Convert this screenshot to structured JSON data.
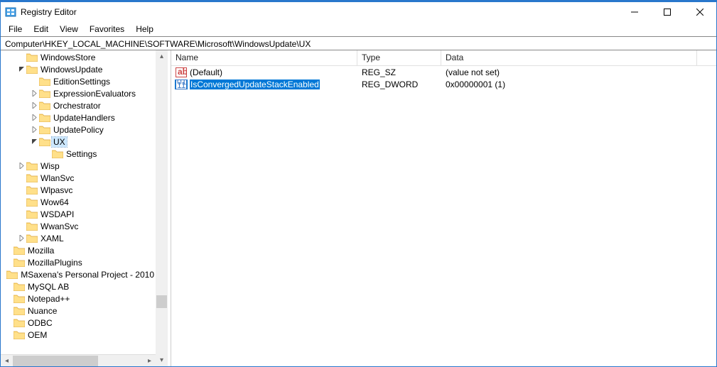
{
  "window": {
    "title": "Registry Editor"
  },
  "menu": {
    "file": "File",
    "edit": "Edit",
    "view": "View",
    "favorites": "Favorites",
    "help": "Help"
  },
  "address": "Computer\\HKEY_LOCAL_MACHINE\\SOFTWARE\\Microsoft\\WindowsUpdate\\UX",
  "tree": [
    {
      "depth": 1,
      "chev": "",
      "label": "WindowsStore"
    },
    {
      "depth": 1,
      "chev": "open",
      "label": "WindowsUpdate"
    },
    {
      "depth": 2,
      "chev": "",
      "label": "EditionSettings"
    },
    {
      "depth": 2,
      "chev": "closed",
      "label": "ExpressionEvaluators"
    },
    {
      "depth": 2,
      "chev": "closed",
      "label": "Orchestrator"
    },
    {
      "depth": 2,
      "chev": "closed",
      "label": "UpdateHandlers"
    },
    {
      "depth": 2,
      "chev": "closed",
      "label": "UpdatePolicy"
    },
    {
      "depth": 2,
      "chev": "open",
      "label": "UX",
      "sel": true
    },
    {
      "depth": 3,
      "chev": "",
      "label": "Settings"
    },
    {
      "depth": 1,
      "chev": "closed",
      "label": "Wisp"
    },
    {
      "depth": 1,
      "chev": "",
      "label": "WlanSvc"
    },
    {
      "depth": 1,
      "chev": "",
      "label": "Wlpasvc"
    },
    {
      "depth": 1,
      "chev": "",
      "label": "Wow64"
    },
    {
      "depth": 1,
      "chev": "",
      "label": "WSDAPI"
    },
    {
      "depth": 1,
      "chev": "",
      "label": "WwanSvc"
    },
    {
      "depth": 1,
      "chev": "closed",
      "label": "XAML"
    },
    {
      "depth": 0,
      "chev": "",
      "label": "Mozilla"
    },
    {
      "depth": 0,
      "chev": "",
      "label": "MozillaPlugins"
    },
    {
      "depth": 0,
      "chev": "",
      "label": "MSaxena's Personal Project - 2010"
    },
    {
      "depth": 0,
      "chev": "",
      "label": "MySQL AB"
    },
    {
      "depth": 0,
      "chev": "",
      "label": "Notepad++"
    },
    {
      "depth": 0,
      "chev": "",
      "label": "Nuance"
    },
    {
      "depth": 0,
      "chev": "",
      "label": "ODBC"
    },
    {
      "depth": 0,
      "chev": "",
      "label": "OEM"
    }
  ],
  "columns": {
    "name": "Name",
    "type": "Type",
    "data": "Data"
  },
  "values": [
    {
      "icon": "string",
      "name": "(Default)",
      "type": "REG_SZ",
      "data": "(value not set)",
      "sel": false
    },
    {
      "icon": "binary",
      "name": "IsConvergedUpdateStackEnabled",
      "type": "REG_DWORD",
      "data": "0x00000001 (1)",
      "sel": true
    }
  ],
  "col_widths": {
    "name": 262,
    "type": 118,
    "data": 360
  }
}
